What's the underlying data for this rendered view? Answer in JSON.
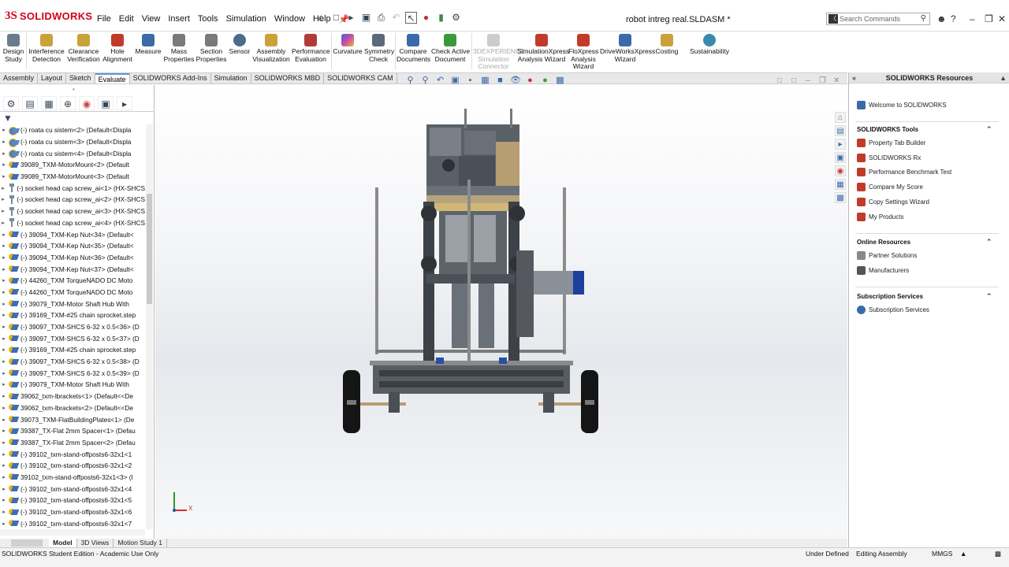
{
  "app": {
    "brand_ds": "3S",
    "brand_name": "SOLIDWORKS",
    "document_title": "robot intreg real.SLDASM *"
  },
  "menu": [
    "File",
    "Edit",
    "View",
    "Insert",
    "Tools",
    "Simulation",
    "Window",
    "Help"
  ],
  "search": {
    "placeholder": "Search Commands"
  },
  "ribbon": {
    "tools": [
      {
        "label": "Design\nStudy",
        "color": "#6a7c8e"
      },
      {
        "label": "Interference\nDetection",
        "color": "#c9a23a"
      },
      {
        "label": "Clearance\nVerification",
        "color": "#c9a23a"
      },
      {
        "label": "Hole\nAlignment",
        "color": "#c23b2a"
      },
      {
        "label": "Measure",
        "color": "#3a6aa8"
      },
      {
        "label": "Mass\nProperties",
        "color": "#7a7a7a"
      },
      {
        "label": "Section\nProperties",
        "color": "#7a7a7a"
      },
      {
        "label": "Sensor",
        "color": "#4a6c8c"
      },
      {
        "label": "Assembly\nVisualization",
        "color": "#c9a23a"
      },
      {
        "label": "Performance\nEvaluation",
        "color": "#b33a3a"
      },
      {
        "label": "Curvature",
        "color": "#d04aa8"
      },
      {
        "label": "Symmetry\nCheck",
        "color": "#5a6a7a"
      },
      {
        "label": "Compare\nDocuments",
        "color": "#3a6aa8"
      },
      {
        "label": "Check Active\nDocument",
        "color": "#3a9a3a"
      },
      {
        "label": "3DEXPERIENCE\nSimulation\nConnector",
        "color": "#bbbbbb",
        "disabled": true
      },
      {
        "label": "SimulationXpress\nAnalysis Wizard",
        "color": "#c23b2a"
      },
      {
        "label": "FloXpress\nAnalysis\nWizard",
        "color": "#c23b2a"
      },
      {
        "label": "DriveWorksXpress\nWizard",
        "color": "#3a6aa8"
      },
      {
        "label": "Costing",
        "color": "#c9a23a"
      },
      {
        "label": "Sustainability",
        "color": "#3a8ab0"
      }
    ]
  },
  "tabs": [
    {
      "label": "Assembly",
      "active": false
    },
    {
      "label": "Layout",
      "active": false
    },
    {
      "label": "Sketch",
      "active": false
    },
    {
      "label": "Evaluate",
      "active": true
    },
    {
      "label": "SOLIDWORKS Add-Ins",
      "active": false
    },
    {
      "label": "Simulation",
      "active": false
    },
    {
      "label": "SOLIDWORKS MBD",
      "active": false
    },
    {
      "label": "SOLIDWORKS CAM",
      "active": false
    }
  ],
  "tree": [
    {
      "icon": "sub",
      "text": "(-) roata cu sistem<2> (Default<Displa"
    },
    {
      "icon": "sub",
      "text": "(-) roata cu sistem<3> (Default<Displa"
    },
    {
      "icon": "sub",
      "text": "(-) roata cu sistem<4> (Default<Displa"
    },
    {
      "icon": "asm",
      "text": "39089_TXM-MotorMount<2> (Default"
    },
    {
      "icon": "asm",
      "text": "39089_TXM-MotorMount<3> (Default"
    },
    {
      "icon": "screw",
      "text": "(-) socket head cap screw_ai<1> (HX-SHCS"
    },
    {
      "icon": "screw",
      "text": "(-) socket head cap screw_ai<2> (HX-SHCS"
    },
    {
      "icon": "screw",
      "text": "(-) socket head cap screw_ai<3> (HX-SHCS"
    },
    {
      "icon": "screw",
      "text": "(-) socket head cap screw_ai<4> (HX-SHCS"
    },
    {
      "icon": "asm",
      "text": "(-) 39094_TXM-Kep Nut<34> (Default<"
    },
    {
      "icon": "asm",
      "text": "(-) 39094_TXM-Kep Nut<35> (Default<"
    },
    {
      "icon": "asm",
      "text": "(-) 39094_TXM-Kep Nut<36> (Default<"
    },
    {
      "icon": "asm",
      "text": "(-) 39094_TXM-Kep Nut<37> (Default<"
    },
    {
      "icon": "asm",
      "text": "(-) 44260_TXM TorqueNADO DC Moto"
    },
    {
      "icon": "asm",
      "text": "(-) 44260_TXM TorqueNADO DC Moto"
    },
    {
      "icon": "asm",
      "text": "(-) 39079_TXM-Motor Shaft Hub With"
    },
    {
      "icon": "asm",
      "text": "(-) 39169_TXM-#25 chain sprocket.step"
    },
    {
      "icon": "asm",
      "text": "(-) 39097_TXM-SHCS 6-32 x 0.5<36> (D"
    },
    {
      "icon": "asm",
      "text": "(-) 39097_TXM-SHCS 6-32 x 0.5<37> (D"
    },
    {
      "icon": "asm",
      "text": "(-) 39169_TXM-#25 chain sprocket.step"
    },
    {
      "icon": "asm",
      "text": "(-) 39097_TXM-SHCS 6-32 x 0.5<38> (D"
    },
    {
      "icon": "asm",
      "text": "(-) 39097_TXM-SHCS 6-32 x 0.5<39> (D"
    },
    {
      "icon": "asm",
      "text": "(-) 39079_TXM-Motor Shaft Hub With"
    },
    {
      "icon": "asm",
      "text": "39062_txm-lbrackets<1> (Default<<De"
    },
    {
      "icon": "asm",
      "text": "39062_txm-lbrackets<2> (Default<<De"
    },
    {
      "icon": "asm",
      "text": "39073_TXM-FlatBuildingPlates<1> (De"
    },
    {
      "icon": "asm",
      "text": "39387_TX-Flat 2mm Spacer<1> (Defau"
    },
    {
      "icon": "asm",
      "text": "39387_TX-Flat 2mm Spacer<2> (Defau"
    },
    {
      "icon": "asm",
      "text": "(-) 39102_txm-stand-offposts6-32x1<1"
    },
    {
      "icon": "asm",
      "text": "(-) 39102_txm-stand-offposts6-32x1<2"
    },
    {
      "icon": "asm",
      "text": "39102_txm-stand-offposts6-32x1<3> (I"
    },
    {
      "icon": "asm",
      "text": "(-) 39102_txm-stand-offposts6-32x1<4"
    },
    {
      "icon": "asm",
      "text": "(-) 39102_txm-stand-offposts6-32x1<5"
    },
    {
      "icon": "asm",
      "text": "(-) 39102_txm-stand-offposts6-32x1<6"
    },
    {
      "icon": "asm",
      "text": "(-) 39102_txm-stand-offposts6-32x1<7"
    }
  ],
  "bottom_tabs": [
    {
      "label": "Model",
      "active": true
    },
    {
      "label": "3D Views",
      "active": false
    },
    {
      "label": "Motion Study 1",
      "active": false
    }
  ],
  "taskpane": {
    "title": "SOLIDWORKS Resources",
    "welcome": "Welcome to SOLIDWORKS",
    "tools_header": "SOLIDWORKS Tools",
    "tools": [
      "Property Tab Builder",
      "SOLIDWORKS Rx",
      "Performance Benchmark Test",
      "Compare My Score",
      "Copy Settings Wizard",
      "My Products"
    ],
    "online_header": "Online Resources",
    "online": [
      "Partner Solutions",
      "Manufacturers"
    ],
    "subs_header": "Subscription Services",
    "subs": [
      "Subscription Services"
    ]
  },
  "triad": {
    "x_label": "X"
  },
  "status": {
    "edition": "SOLIDWORKS Student Edition - Academic Use Only",
    "state": "Under Defined",
    "mode": "Editing Assembly",
    "units": "MMGS"
  }
}
